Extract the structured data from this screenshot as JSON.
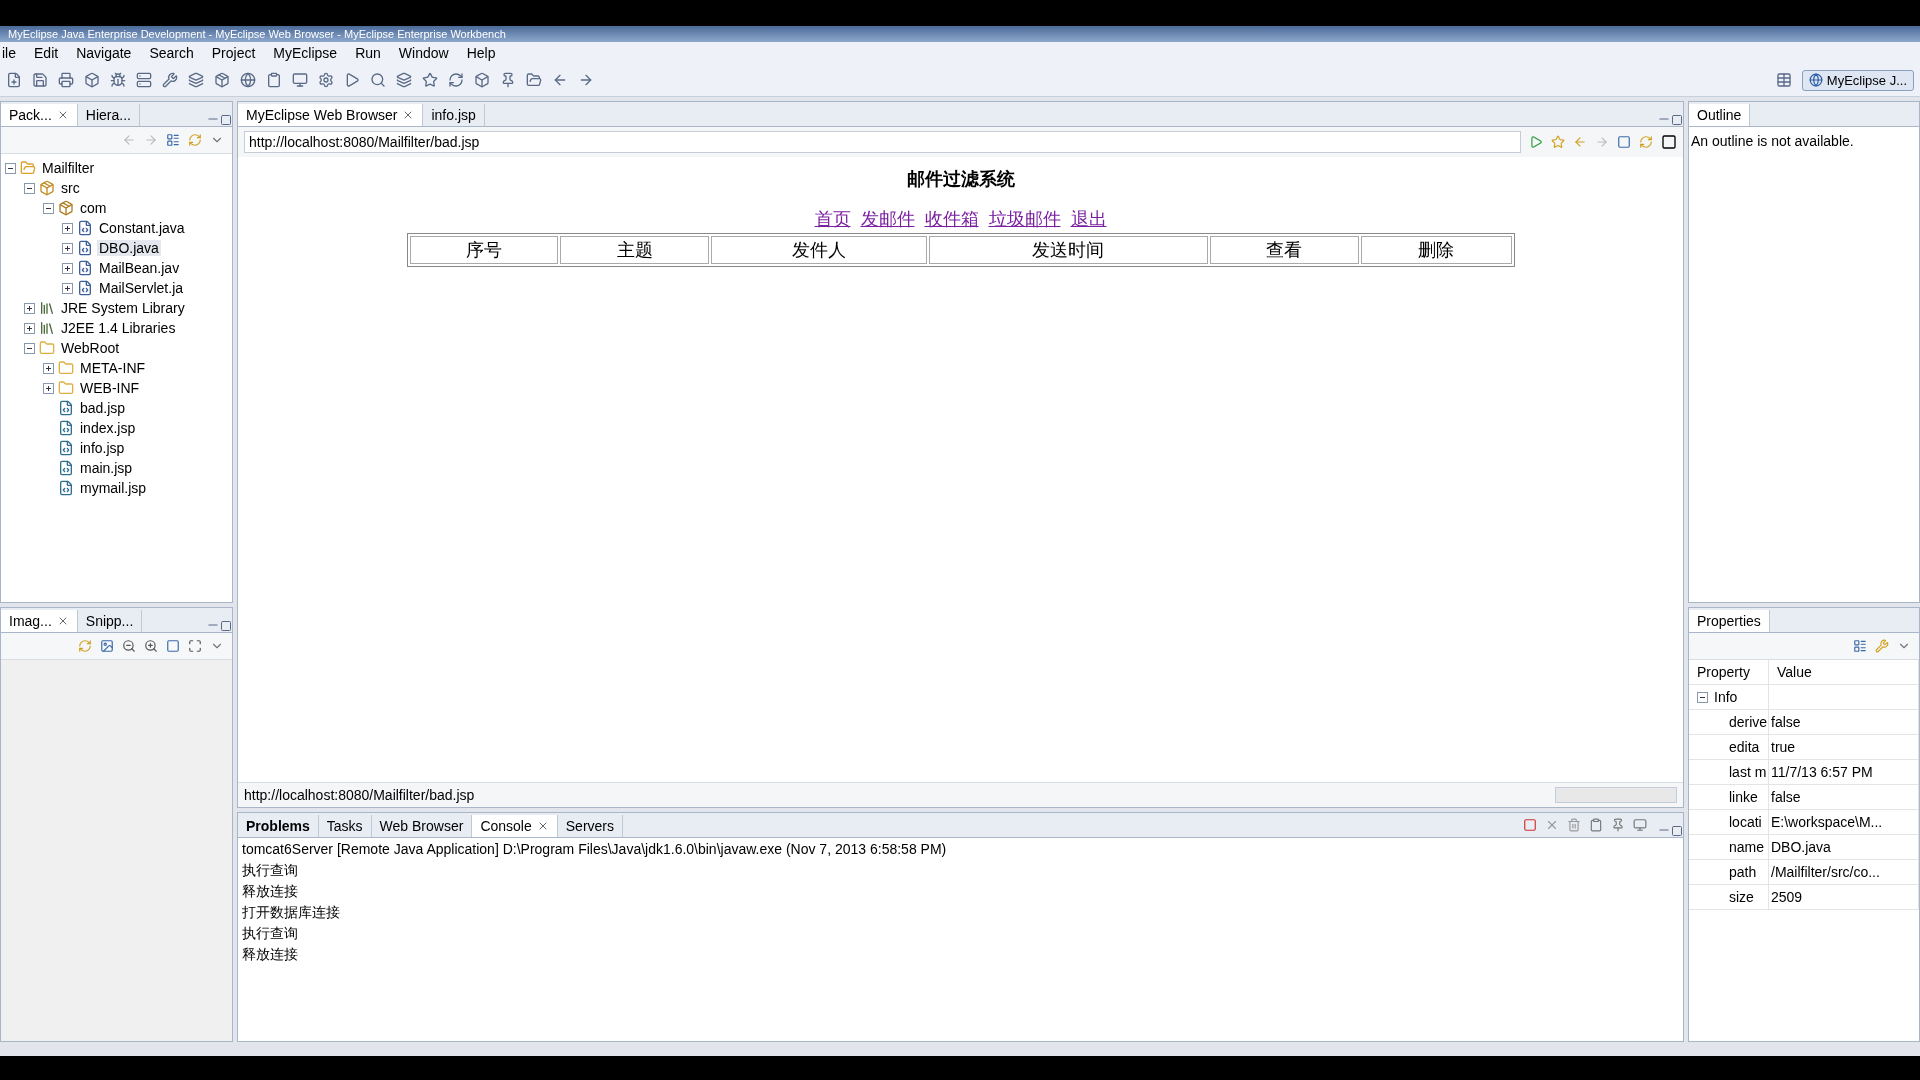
{
  "window": {
    "title": "MyEclipse Java Enterprise Development - MyEclipse Web Browser - MyEclipse Enterprise Workbench"
  },
  "menu": [
    "ile",
    "Edit",
    "Navigate",
    "Search",
    "Project",
    "MyEclipse",
    "Run",
    "Window",
    "Help"
  ],
  "perspective": {
    "label": "MyEclipse J..."
  },
  "package_view": {
    "tabs": [
      {
        "label": "Pack...",
        "selected": true
      },
      {
        "label": "Hiera...",
        "selected": false
      }
    ],
    "tree": [
      {
        "label": "Mailfilter",
        "kind": "project",
        "expanded": true,
        "selected": false,
        "children": [
          {
            "label": "src",
            "kind": "source",
            "expanded": true,
            "selected": false,
            "children": [
              {
                "label": "com",
                "kind": "package",
                "expanded": true,
                "selected": false,
                "children": [
                  {
                    "label": "Constant.java",
                    "kind": "java",
                    "expanded": false,
                    "selected": false
                  },
                  {
                    "label": "DBO.java",
                    "kind": "java",
                    "expanded": false,
                    "selected": true
                  },
                  {
                    "label": "MailBean.jav",
                    "kind": "java",
                    "expanded": false,
                    "selected": false
                  },
                  {
                    "label": "MailServlet.ja",
                    "kind": "java",
                    "expanded": false,
                    "selected": false
                  }
                ]
              }
            ]
          },
          {
            "label": "JRE System Library",
            "kind": "library",
            "expanded": false,
            "selected": false
          },
          {
            "label": "J2EE 1.4 Libraries",
            "kind": "library",
            "expanded": false,
            "selected": false
          },
          {
            "label": "WebRoot",
            "kind": "folder",
            "expanded": true,
            "selected": false,
            "children": [
              {
                "label": "META-INF",
                "kind": "folder",
                "expanded": false,
                "selected": false
              },
              {
                "label": "WEB-INF",
                "kind": "folder",
                "expanded": false,
                "selected": false
              },
              {
                "label": "bad.jsp",
                "kind": "jsp",
                "selected": false
              },
              {
                "label": "index.jsp",
                "kind": "jsp",
                "selected": false
              },
              {
                "label": "info.jsp",
                "kind": "jsp",
                "selected": false
              },
              {
                "label": "main.jsp",
                "kind": "jsp",
                "selected": false
              },
              {
                "label": "mymail.jsp",
                "kind": "jsp",
                "selected": false
              }
            ]
          }
        ]
      }
    ]
  },
  "image_view": {
    "tabs": [
      {
        "label": "Imag...",
        "selected": true
      },
      {
        "label": "Snipp...",
        "selected": false
      }
    ]
  },
  "editor": {
    "tabs": [
      {
        "label": "MyEclipse Web Browser",
        "selected": true
      },
      {
        "label": "info.jsp",
        "selected": false
      }
    ],
    "url": "http://localhost:8080/Mailfilter/bad.jsp",
    "page_title": "邮件过滤系统",
    "links": [
      "首页",
      "发邮件",
      "收件箱",
      "垃圾邮件",
      "退出"
    ],
    "columns": [
      "序号",
      "主题",
      "发件人",
      "发送时间",
      "查看",
      "删除"
    ],
    "status_url": "http://localhost:8080/Mailfilter/bad.jsp"
  },
  "outline": {
    "tab": "Outline",
    "message": "An outline is not available."
  },
  "console_view": {
    "tabs": [
      {
        "label": "Problems",
        "selected": false,
        "bold": true
      },
      {
        "label": "Tasks",
        "selected": false,
        "bold": false
      },
      {
        "label": "Web Browser",
        "selected": false,
        "bold": false
      },
      {
        "label": "Console",
        "selected": true,
        "bold": false
      },
      {
        "label": "Servers",
        "selected": false,
        "bold": false
      }
    ],
    "header": "tomcat6Server [Remote Java Application] D:\\Program Files\\Java\\jdk1.6.0\\bin\\javaw.exe (Nov 7, 2013 6:58:58 PM)",
    "lines": [
      "执行查询",
      "释放连接",
      "打开数据库连接",
      "执行查询",
      "释放连接"
    ]
  },
  "properties": {
    "tab": "Properties",
    "columns": [
      "Property",
      "Value"
    ],
    "group": {
      "label": "Info",
      "expanded": true
    },
    "rows": [
      {
        "name": "derive",
        "value": "false"
      },
      {
        "name": "edita",
        "value": "true"
      },
      {
        "name": "last m",
        "value": "11/7/13 6:57 PM"
      },
      {
        "name": "linke",
        "value": "false"
      },
      {
        "name": "locati",
        "value": "E:\\workspace\\M..."
      },
      {
        "name": "name",
        "value": "DBO.java"
      },
      {
        "name": "path",
        "value": "/Mailfilter/src/co..."
      },
      {
        "name": "size",
        "value": "2509"
      }
    ]
  }
}
